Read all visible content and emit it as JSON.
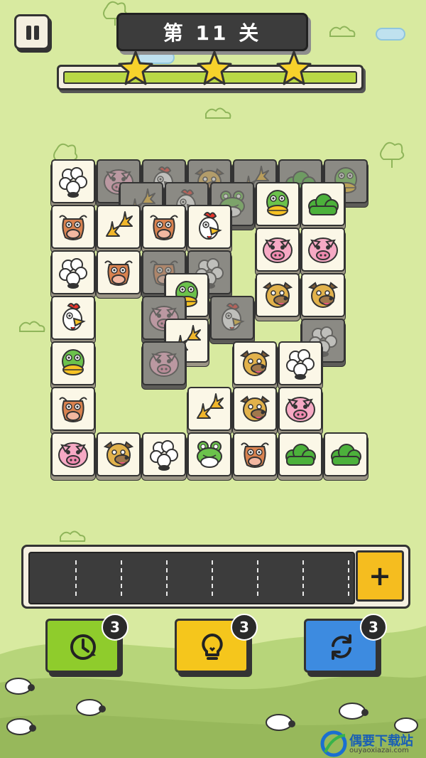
{
  "header": {
    "pause_icon": "pause-icon",
    "level_title": "第 11 关"
  },
  "progress": {
    "fill_fraction": 1.0,
    "stars": [
      "star-icon",
      "star-icon",
      "star-icon"
    ]
  },
  "board": {
    "tiles": [
      {
        "id": "t1",
        "animal": "sheep",
        "dim": false
      },
      {
        "id": "t2",
        "animal": "pig",
        "dim": true
      },
      {
        "id": "t3",
        "animal": "rooster",
        "dim": true
      },
      {
        "id": "t4",
        "animal": "dog",
        "dim": true
      },
      {
        "id": "t5",
        "animal": "footprints",
        "dim": true
      },
      {
        "id": "t6",
        "animal": "bush",
        "dim": true
      },
      {
        "id": "t7",
        "animal": "duck",
        "dim": true
      },
      {
        "id": "t8",
        "animal": "footprints",
        "dim": true
      },
      {
        "id": "t9",
        "animal": "rooster",
        "dim": true
      },
      {
        "id": "t10",
        "animal": "frog",
        "dim": true
      },
      {
        "id": "t11",
        "animal": "duck",
        "dim": false
      },
      {
        "id": "t12",
        "animal": "bush",
        "dim": false
      },
      {
        "id": "t13",
        "animal": "cow",
        "dim": false
      },
      {
        "id": "t14",
        "animal": "footprints",
        "dim": false
      },
      {
        "id": "t15",
        "animal": "cow",
        "dim": false
      },
      {
        "id": "t16",
        "animal": "rooster",
        "dim": false
      },
      {
        "id": "t17",
        "animal": "pig",
        "dim": false
      },
      {
        "id": "t18",
        "animal": "pig",
        "dim": false
      },
      {
        "id": "t19",
        "animal": "sheep",
        "dim": false
      },
      {
        "id": "t20",
        "animal": "cow",
        "dim": false
      },
      {
        "id": "t21",
        "animal": "cow",
        "dim": true
      },
      {
        "id": "t22",
        "animal": "sheep",
        "dim": true
      },
      {
        "id": "t23",
        "animal": "dog",
        "dim": false
      },
      {
        "id": "t24",
        "animal": "dog",
        "dim": false
      },
      {
        "id": "t25",
        "animal": "duck",
        "dim": false
      },
      {
        "id": "t26",
        "animal": "rooster",
        "dim": false
      },
      {
        "id": "t27",
        "animal": "pig",
        "dim": true
      },
      {
        "id": "t28",
        "animal": "rooster",
        "dim": true
      },
      {
        "id": "t29",
        "animal": "sheep",
        "dim": true
      },
      {
        "id": "t30",
        "animal": "footprints",
        "dim": false
      },
      {
        "id": "t31",
        "animal": "duck",
        "dim": false
      },
      {
        "id": "t32",
        "animal": "pig",
        "dim": true
      },
      {
        "id": "t33",
        "animal": "dog",
        "dim": false
      },
      {
        "id": "t34",
        "animal": "sheep",
        "dim": false
      },
      {
        "id": "t35",
        "animal": "cow",
        "dim": false
      },
      {
        "id": "t36",
        "animal": "footprints",
        "dim": false
      },
      {
        "id": "t37",
        "animal": "dog",
        "dim": false
      },
      {
        "id": "t38",
        "animal": "pig",
        "dim": false
      },
      {
        "id": "t39",
        "animal": "pig",
        "dim": false
      },
      {
        "id": "t40",
        "animal": "dog",
        "dim": false
      },
      {
        "id": "t41",
        "animal": "sheep",
        "dim": false
      },
      {
        "id": "t42",
        "animal": "frog",
        "dim": false
      },
      {
        "id": "t43",
        "animal": "cow",
        "dim": false
      },
      {
        "id": "t44",
        "animal": "bush",
        "dim": false
      },
      {
        "id": "t45",
        "animal": "bush",
        "dim": false
      }
    ]
  },
  "tray": {
    "slot_count": 7,
    "add_label": "+"
  },
  "powerups": [
    {
      "name": "undo-powerup-button",
      "icon": "clock-rewind-icon",
      "count": "3",
      "color": "#8fcc2c"
    },
    {
      "name": "hint-powerup-button",
      "icon": "lightbulb-icon",
      "count": "3",
      "color": "#f5c61c"
    },
    {
      "name": "shuffle-powerup-button",
      "icon": "shuffle-arrows-icon",
      "count": "3",
      "color": "#3d8be0"
    }
  ],
  "watermark": {
    "title": "偶要下载站",
    "url": "ouyaoxiazai.com",
    "icon": "watermark-logo-icon"
  },
  "colors": {
    "background": "#d8eaa0",
    "hill": "#a7c66a",
    "tile_face": "#fbf7e7",
    "tile_dim": "#8b8a84"
  }
}
